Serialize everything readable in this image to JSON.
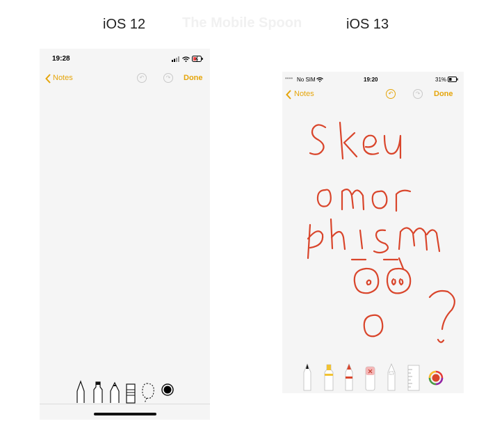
{
  "labels": {
    "left": "iOS 12",
    "watermark": "The Mobile Spoon",
    "right": "iOS 13"
  },
  "ios12": {
    "status": {
      "time": "19:28"
    },
    "nav": {
      "back_label": "Notes",
      "done_label": "Done"
    },
    "tools": [
      "pen",
      "marker",
      "pencil",
      "eraser",
      "lasso",
      "color"
    ],
    "icons": [
      "chevron-left-icon",
      "undo-icon",
      "redo-icon",
      "signal-icon",
      "wifi-icon",
      "battery-charging-icon"
    ]
  },
  "ios13": {
    "status": {
      "carrier": "No SIM",
      "time": "19:20",
      "battery": "31%"
    },
    "nav": {
      "back_label": "Notes",
      "done_label": "Done"
    },
    "tools": [
      "pen",
      "marker",
      "pencil",
      "eraser",
      "lasso",
      "ruler",
      "color-picker"
    ],
    "drawing_words": [
      "skeu",
      "omor",
      "phism",
      "ōō'",
      "o",
      "?"
    ],
    "ink_color": "#d9452b",
    "accent_color": "#e5a50a"
  }
}
